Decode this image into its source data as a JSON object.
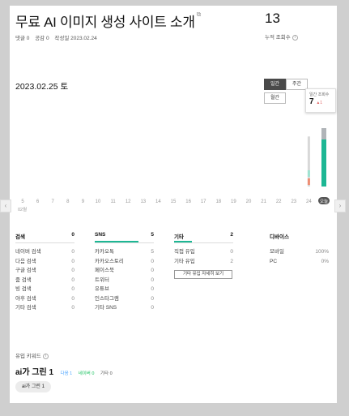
{
  "post": {
    "title": "무료 AI 이미지 생성 사이트 소개",
    "comments": "댓글 0",
    "likes": "공감 0",
    "date": "작성일 2023.02.24"
  },
  "total": {
    "value": "13",
    "label": "누적 조회수"
  },
  "chart_header": {
    "date": "2023.02.25 토"
  },
  "period_tabs": {
    "day": "일간",
    "week": "주간",
    "month": "월간"
  },
  "tooltip": {
    "label": "일간 조회수",
    "value": "7",
    "delta": "▲1"
  },
  "chart_data": {
    "type": "bar",
    "categories": [
      "5",
      "6",
      "7",
      "8",
      "9",
      "10",
      "11",
      "12",
      "13",
      "14",
      "15",
      "16",
      "17",
      "18",
      "19",
      "20",
      "21",
      "22",
      "23",
      "24",
      "오늘"
    ],
    "month_label": "02월",
    "series": [
      {
        "values": [
          0,
          0,
          0,
          0,
          0,
          0,
          0,
          0,
          0,
          0,
          0,
          0,
          0,
          0,
          0,
          0,
          0,
          0,
          0,
          6,
          7
        ]
      }
    ],
    "ylim": [
      0,
      7
    ],
    "colors": {
      "bar_today": "#1db794",
      "bar_prev": "#d8d8d8",
      "bar_marker": "#ee8e74"
    }
  },
  "stats": {
    "search": {
      "title": "검색",
      "total": "0",
      "rows": [
        {
          "label": "네이버 검색",
          "value": "0"
        },
        {
          "label": "다음 검색",
          "value": "0"
        },
        {
          "label": "구글 검색",
          "value": "0"
        },
        {
          "label": "줌 검색",
          "value": "0"
        },
        {
          "label": "빙 검색",
          "value": "0"
        },
        {
          "label": "야후 검색",
          "value": "0"
        },
        {
          "label": "기타 검색",
          "value": "0"
        }
      ]
    },
    "sns": {
      "title": "SNS",
      "total": "5",
      "rows": [
        {
          "label": "카카오톡",
          "value": "5"
        },
        {
          "label": "카카오스토리",
          "value": "0"
        },
        {
          "label": "페이스북",
          "value": "0"
        },
        {
          "label": "트위터",
          "value": "0"
        },
        {
          "label": "유튜브",
          "value": "0"
        },
        {
          "label": "인스타그램",
          "value": "0"
        },
        {
          "label": "기타 SNS",
          "value": "0"
        }
      ]
    },
    "etc": {
      "title": "기타",
      "total": "2",
      "rows": [
        {
          "label": "직접 유입",
          "value": "0"
        },
        {
          "label": "기타 유입",
          "value": "2"
        }
      ],
      "button": "기타 유입 자세히 보기"
    },
    "device": {
      "title": "디바이스",
      "rows": [
        {
          "label": "모바일",
          "value": "100%"
        },
        {
          "label": "PC",
          "value": "0%"
        }
      ]
    }
  },
  "keywords": {
    "label": "유입 키워드",
    "main": "ai가 그린 1",
    "daum": "다음 1",
    "naver": "네이버 0",
    "other": "기타 0",
    "chip": "ai가 그린 1",
    "colors": {
      "daum": "#4ea5ff",
      "naver": "#19c35f",
      "other": "#555555"
    }
  }
}
